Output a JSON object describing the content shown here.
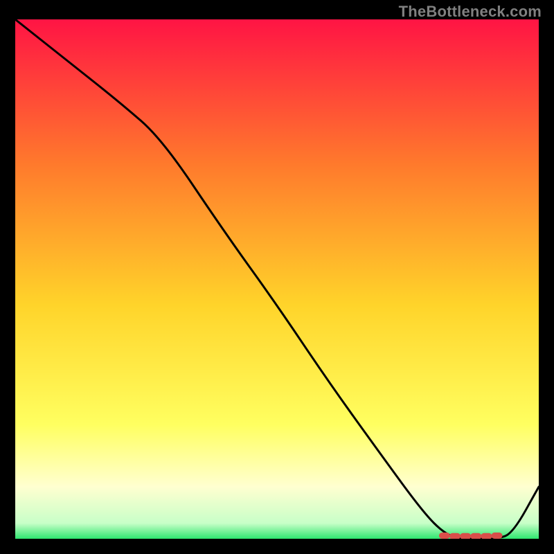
{
  "watermark": "TheBottleneck.com",
  "colors": {
    "gradient_top": "#ff1444",
    "gradient_mid_upper": "#ff7a2c",
    "gradient_mid": "#ffd42a",
    "gradient_mid_lower": "#ffff60",
    "gradient_pale": "#ffffd0",
    "gradient_green": "#2ee66f",
    "line": "#000000",
    "marker": "#d94e4a",
    "frame": "#000000"
  },
  "chart_data": {
    "type": "line",
    "title": "",
    "xlabel": "",
    "ylabel": "",
    "xlim": [
      0,
      100
    ],
    "ylim": [
      0,
      100
    ],
    "grid": false,
    "legend": false,
    "series": [
      {
        "name": "bottleneck-curve",
        "x": [
          0,
          10,
          20,
          28,
          40,
          50,
          60,
          70,
          78,
          82,
          85,
          88,
          90,
          92,
          95,
          100
        ],
        "y": [
          100,
          92,
          84,
          77,
          59,
          45,
          30,
          16,
          5,
          1,
          0,
          0,
          0,
          0,
          1,
          10
        ]
      }
    ],
    "markers": {
      "name": "optimal-range",
      "shape": "rounded",
      "x": [
        82,
        84,
        86,
        88,
        90,
        92
      ],
      "y": [
        0.6,
        0.5,
        0.5,
        0.5,
        0.5,
        0.6
      ]
    }
  }
}
